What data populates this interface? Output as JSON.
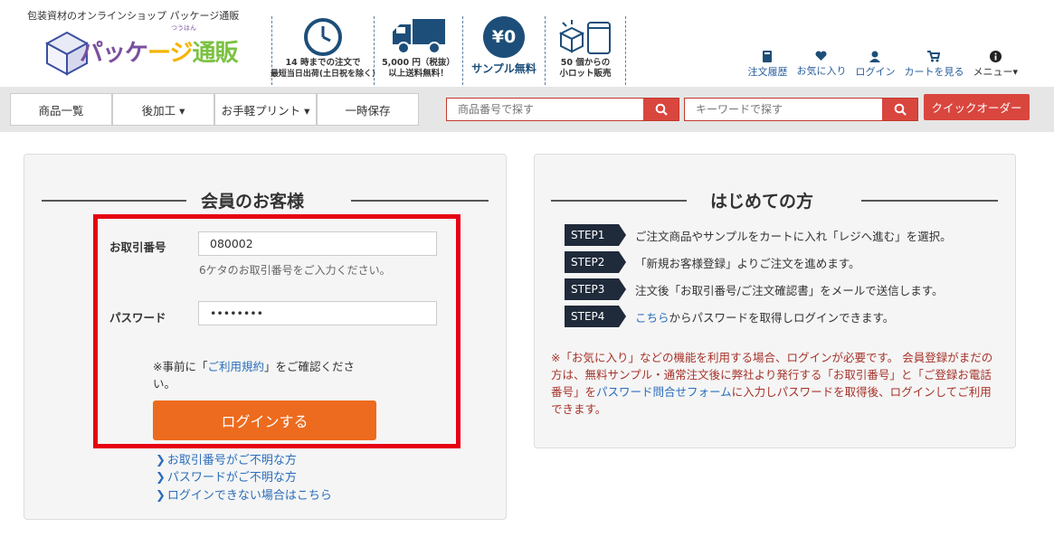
{
  "header": {
    "tagline": "包装資材のオンラインショップ パッケージ通販",
    "logo": {
      "text_part1": "パッケ",
      "text_part2": "ージ",
      "text_part3": "通販",
      "ruby": "つうはん"
    },
    "features": [
      {
        "icon": "clock-icon",
        "line1": "14 時までの注文で",
        "line2": "最短当日出荷(土日祝を除く)"
      },
      {
        "icon": "truck-icon",
        "line1": "5,000 円（税抜）",
        "line2": "以上送料無料！"
      },
      {
        "icon": "yen-zero-icon",
        "badge": "¥0",
        "line1": "サンプル無料"
      },
      {
        "icon": "boxes-icon",
        "line1": "50 個からの",
        "line2": "小ロット販売"
      }
    ],
    "user_nav": [
      {
        "icon": "book-icon",
        "label": "注文履歴"
      },
      {
        "icon": "heart-icon",
        "label": "お気に入り"
      },
      {
        "icon": "user-icon",
        "label": "ログイン"
      },
      {
        "icon": "cart-icon",
        "label": "カートを見る"
      },
      {
        "icon": "info-icon",
        "label": "メニュー▾"
      }
    ]
  },
  "navbar": {
    "items": [
      "商品一覧",
      "後加工 ▾",
      "お手軽プリント ▾",
      "一時保存"
    ],
    "search_product": {
      "placeholder": "商品番号で探す"
    },
    "search_keyword": {
      "placeholder": "キーワードで探す"
    },
    "quick_order": "クイックオーダー"
  },
  "member": {
    "title": "会員のお客様",
    "id_label": "お取引番号",
    "id_value": "080002",
    "id_help": "6ケタのお取引番号をご入力ください。",
    "password_label": "パスワード",
    "password_value": "••••••••",
    "note_prefix": "※事前に「",
    "note_link": "ご利用規約",
    "note_suffix": "」をご確認ください。",
    "login_button": "ログインする",
    "help_links": [
      "お取引番号がご不明な方",
      "パスワードがご不明な方",
      "ログインできない場合はこちら"
    ]
  },
  "first_time": {
    "title": "はじめての方",
    "steps": [
      {
        "badge": "STEP1",
        "text": "ご注文商品やサンプルをカートに入れ「レジへ進む」を選択。"
      },
      {
        "badge": "STEP2",
        "text": "「新規お客様登録」よりご注文を進めます。"
      },
      {
        "badge": "STEP3",
        "text": "注文後「お取引番号/ご注文確認書」をメールで送信します。"
      },
      {
        "badge": "STEP4",
        "link": "こちら",
        "text": "からパスワードを取得しログインできます。"
      }
    ],
    "warning_part1": "※「お気に入り」などの機能を利用する場合、ログインが必要です。 会員登録がまだの方は、無料サンプル・通常注文後に弊社より発行する「お取引番号」と「ご登録お電話番号」を",
    "warning_link": "パスワード問合せフォーム",
    "warning_part2": "に入力しパスワードを取得後、ログインしてご利用できます。"
  },
  "colors": {
    "accent_red": "#d9463e",
    "login_orange": "#ed6b1e",
    "link_blue": "#2a6ebb",
    "highlight_red": "#e60012",
    "step_dark": "#1f2a3a"
  }
}
